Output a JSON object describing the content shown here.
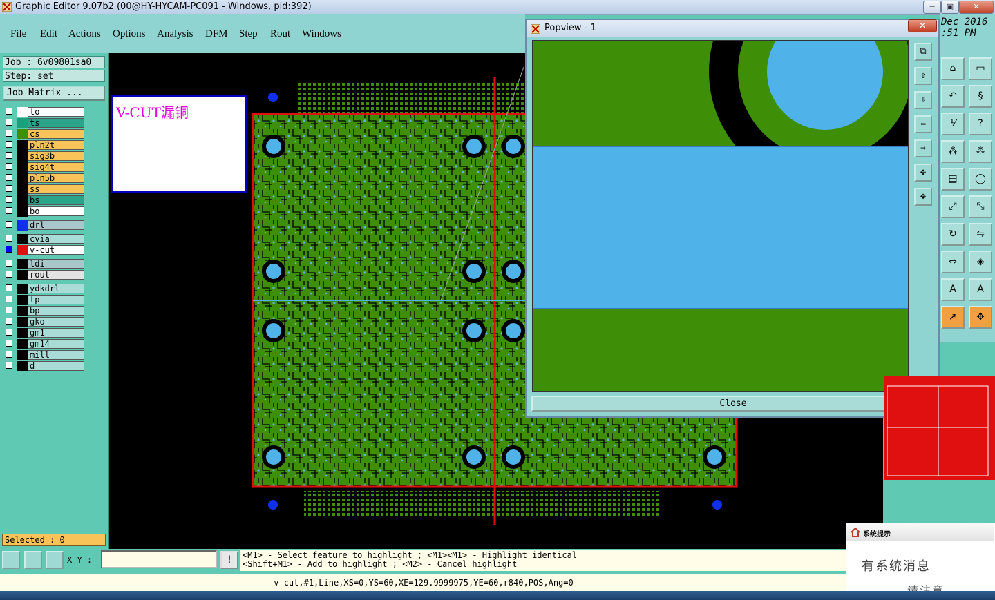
{
  "window": {
    "title": "Graphic Editor 9.07b2 (00@HY-HYCAM-PC091 - Windows, pid:392)",
    "min": "─",
    "max": "▣",
    "close": "✕"
  },
  "menu": {
    "items": [
      {
        "label": "File"
      },
      {
        "label": "Edit"
      },
      {
        "label": "Actions"
      },
      {
        "label": "Options"
      },
      {
        "label": "Analysis"
      },
      {
        "label": "DFM"
      },
      {
        "label": "Step"
      },
      {
        "label": "Rout"
      },
      {
        "label": "Windows"
      }
    ]
  },
  "header": {
    "date_line1": "Dec 2016",
    "date_line2": ":51 PM"
  },
  "job": {
    "job_line": "Job : 6v09801sa0",
    "step_line": "Step: set",
    "matrix_label": "Job Matrix ..."
  },
  "layers": [
    {
      "name": "to",
      "color": "#ffffff",
      "bg": "#ffffff",
      "checked": false
    },
    {
      "name": "ts",
      "color": "#1aa07a",
      "bg": "#2aa58a",
      "checked": false
    },
    {
      "name": "cs",
      "color": "#3e8f07",
      "bg": "#f8c45a",
      "checked": false
    },
    {
      "name": "pln2t",
      "color": "#000000",
      "bg": "#f8c45a",
      "checked": false
    },
    {
      "name": "sig3b",
      "color": "#000000",
      "bg": "#f8c45a",
      "checked": false
    },
    {
      "name": "sig4t",
      "color": "#000000",
      "bg": "#f8c45a",
      "checked": false
    },
    {
      "name": "pln5b",
      "color": "#000000",
      "bg": "#f8c45a",
      "checked": false
    },
    {
      "name": "ss",
      "color": "#000000",
      "bg": "#f8c45a",
      "checked": false
    },
    {
      "name": "bs",
      "color": "#000000",
      "bg": "#2aa58a",
      "checked": false
    },
    {
      "name": "bo",
      "color": "#000000",
      "bg": "#ffffff",
      "checked": false
    },
    {
      "name": "drl",
      "color": "#1030f0",
      "bg": "#a9c6cb",
      "checked": false
    },
    {
      "name": "cvia",
      "color": "#000000",
      "bg": "#a9dcd7",
      "checked": false
    },
    {
      "name": "v-cut",
      "color": "#e01010",
      "bg": "#ffffff",
      "checked": true
    },
    {
      "name": "ldi",
      "color": "#000000",
      "bg": "#a9c6cb",
      "checked": false
    },
    {
      "name": "rout",
      "color": "#000000",
      "bg": "#e3e3e3",
      "checked": false
    },
    {
      "name": "ydkdrl",
      "color": "#000000",
      "bg": "#a9dcd7",
      "checked": false
    },
    {
      "name": "tp",
      "color": "#000000",
      "bg": "#a9dcd7",
      "checked": false
    },
    {
      "name": "bp",
      "color": "#000000",
      "bg": "#a9dcd7",
      "checked": false
    },
    {
      "name": "gko",
      "color": "#000000",
      "bg": "#a9dcd7",
      "checked": false
    },
    {
      "name": "gm1",
      "color": "#000000",
      "bg": "#a9dcd7",
      "checked": false
    },
    {
      "name": "gm14",
      "color": "#000000",
      "bg": "#a9dcd7",
      "checked": false
    },
    {
      "name": "mill",
      "color": "#000000",
      "bg": "#a9dcd7",
      "checked": false
    },
    {
      "name": "d",
      "color": "#000000",
      "bg": "#a9dcd7",
      "checked": false
    }
  ],
  "selected_label": "Selected : 0",
  "note": {
    "text": "V-CUT漏铜"
  },
  "popview": {
    "title": "Popview - 1",
    "close_x": "✕",
    "close_label": "Close"
  },
  "xy": {
    "label": "X Y :",
    "value": "",
    "bang": "!"
  },
  "hint": {
    "line1": "<M1> - Select feature to highlight ; <M1><M1> - Highlight identical",
    "line2": "<Shift+M1> - Add to highlight ; <M2> - Cancel highlight"
  },
  "status": {
    "text": "v-cut,#1,Line,XS=0,YS=60,XE=129.9999975,YE=60,r840,POS,Ang=0"
  },
  "notify": {
    "title": "系统提示",
    "body": "有系统消息",
    "body2": "请注意"
  },
  "colors": {
    "copper": "#3e8f07",
    "pad": "#4fb3ea",
    "vcut": "#e01010",
    "panel": "#5fc9b3"
  }
}
